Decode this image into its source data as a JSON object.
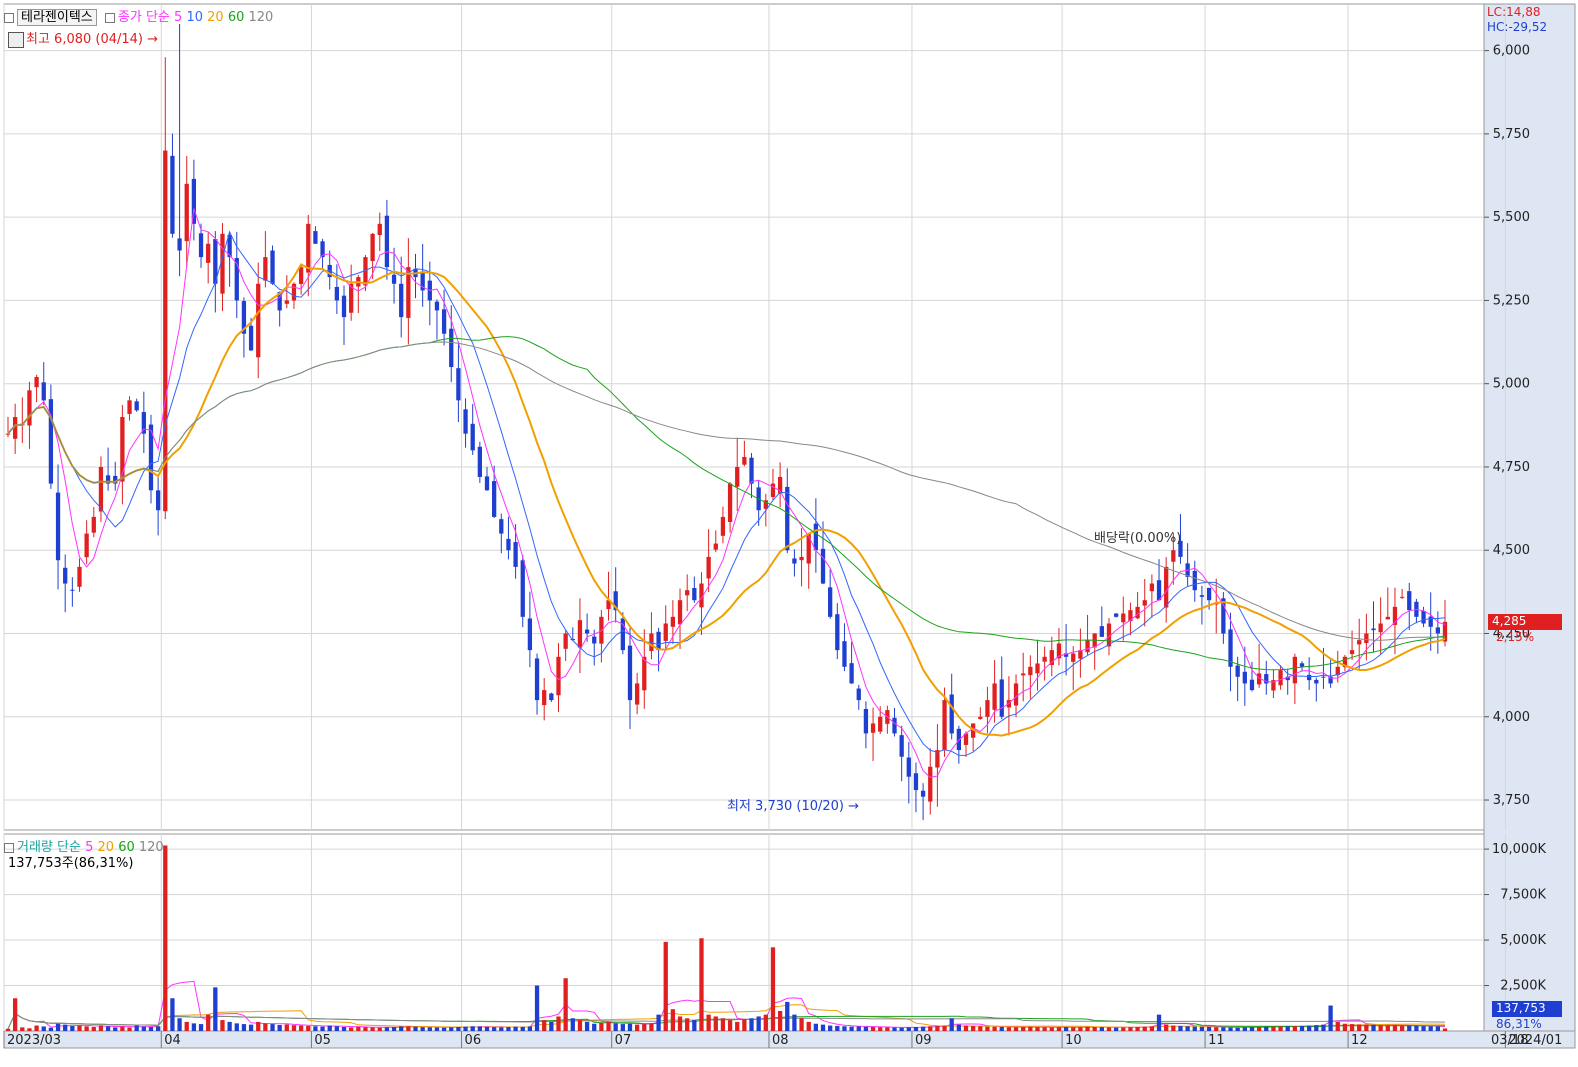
{
  "price_legend": {
    "stock_name": "테라젠이텍스",
    "label": "종가 단순",
    "periods": [
      "5",
      "10",
      "20",
      "60",
      "120"
    ]
  },
  "volume_legend": {
    "label": "거래량 단순",
    "periods": [
      "5",
      "20",
      "60",
      "120"
    ],
    "current_volume": "137,753주(86,31%)"
  },
  "annotations": {
    "high": "최고 6,080 (04/14)",
    "low": "최저 3,730 (10/20)",
    "dividend": "배당락(0.00%)",
    "lc": "LC:14,88",
    "hc": "HC:-29,52",
    "last_price": "4,285",
    "last_change": "2,15%",
    "last_volume": "137,753",
    "last_volume_pct": "86,31%"
  },
  "colors": {
    "up": "#e02020",
    "down": "#1f3fd0",
    "ma5": "#ff33ff",
    "ma10": "#3366ff",
    "ma20": "#f0a000",
    "ma60": "#1aa31a",
    "ma120": "#888888",
    "axis_bg": "#dfe6f3",
    "grid": "#d6d6d6"
  },
  "chart_data": [
    {
      "type": "candlestick",
      "x_ticks": [
        "2023/03",
        "04",
        "05",
        "06",
        "07",
        "08",
        "09",
        "10",
        "11",
        "12",
        "2024/01",
        "02",
        "03",
        "03/18"
      ],
      "y_ticks": [
        "6,000",
        "5,750",
        "5,500",
        "5,250",
        "5,000",
        "4,750",
        "4,500",
        "4,250",
        "4,000",
        "3,750"
      ],
      "ylim": [
        3660,
        6140
      ],
      "moving_averages": [
        "5",
        "10",
        "20",
        "60",
        "120"
      ],
      "series": [
        {
          "name": "종가",
          "values": [
            4850,
            4900,
            4880,
            4980,
            5020,
            4950,
            4700,
            4470,
            4400,
            4380,
            4450,
            4550,
            4600,
            4750,
            4700,
            4700,
            4900,
            4950,
            4920,
            4850,
            4680,
            4620,
            5700,
            5450,
            5400,
            5600,
            5480,
            5380,
            5420,
            5300,
            5450,
            5380,
            5250,
            5150,
            5100,
            5300,
            5380,
            5300,
            5220,
            5250,
            5300,
            5350,
            5480,
            5420,
            5380,
            5320,
            5250,
            5200,
            5300,
            5320,
            5380,
            5450,
            5480,
            5350,
            5300,
            5200,
            5350,
            5320,
            5280,
            5250,
            5220,
            5150,
            5050,
            4950,
            4850,
            4800,
            4720,
            4680,
            4600,
            4550,
            4500,
            4450,
            4300,
            4200,
            4050,
            4080,
            4050,
            4180,
            4250,
            4230,
            4290,
            4250,
            4220,
            4300,
            4350,
            4320,
            4200,
            4050,
            4100,
            4180,
            4250,
            4200,
            4280,
            4300,
            4350,
            4380,
            4350,
            4400,
            4480,
            4520,
            4600,
            4700,
            4750,
            4780,
            4700,
            4620,
            4650,
            4700,
            4720,
            4500,
            4460,
            4480,
            4550,
            4500,
            4400,
            4300,
            4200,
            4150,
            4100,
            4050,
            3950,
            3980,
            4000,
            4020,
            3950,
            3880,
            3820,
            3780,
            3760,
            3850,
            3900,
            4050,
            3950,
            3900,
            3950,
            3980,
            4000,
            4050,
            4100,
            4000,
            4050,
            4100,
            4130,
            4150,
            4160,
            4180,
            4200,
            4220,
            4180,
            4190,
            4200,
            4230,
            4250,
            4240,
            4280,
            4300,
            4310,
            4320,
            4330,
            4350,
            4400,
            4350,
            4450,
            4500,
            4480,
            4420,
            4380,
            4360,
            4350,
            4340,
            4250,
            4150,
            4120,
            4100,
            4080,
            4130,
            4100,
            4110,
            4140,
            4110,
            4180,
            4150,
            4110,
            4100,
            4120,
            4100,
            4150,
            4180,
            4200,
            4230,
            4250,
            4260,
            4280,
            4300,
            4330,
            4360,
            4320,
            4300,
            4280,
            4270,
            4250,
            4285
          ]
        }
      ],
      "high": {
        "value": 6080,
        "date": "04/14"
      },
      "low": {
        "value": 3730,
        "date": "10/20"
      },
      "last_close": 4285
    },
    {
      "type": "bar",
      "title": "거래량",
      "y_ticks": [
        "10,000K",
        "7,500K",
        "5,000K",
        "2,500K"
      ],
      "ylim": [
        0,
        10500
      ],
      "series": [
        {
          "name": "거래량",
          "values": [
            120,
            1800,
            200,
            150,
            300,
            250,
            180,
            400,
            350,
            280,
            300,
            260,
            220,
            310,
            260,
            200,
            240,
            190,
            300,
            250,
            220,
            260,
            10200,
            1800,
            700,
            500,
            420,
            380,
            900,
            2400,
            600,
            500,
            420,
            380,
            350,
            500,
            420,
            380,
            330,
            360,
            320,
            300,
            280,
            260,
            240,
            300,
            260,
            220,
            200,
            230,
            210,
            190,
            180,
            200,
            220,
            250,
            260,
            240,
            210,
            200,
            190,
            180,
            200,
            220,
            240,
            260,
            250,
            230,
            210,
            200,
            220,
            240,
            230,
            250,
            2500,
            600,
            500,
            800,
            2900,
            700,
            600,
            500,
            400,
            450,
            500,
            420,
            380,
            400,
            350,
            380,
            420,
            900,
            4900,
            1200,
            800,
            700,
            600,
            5100,
            900,
            800,
            700,
            600,
            500,
            650,
            700,
            800,
            900,
            4600,
            1100,
            1600,
            900,
            700,
            500,
            400,
            350,
            300,
            280,
            260,
            240,
            250,
            230,
            220,
            210,
            200,
            190,
            180,
            200,
            220,
            240,
            260,
            280,
            300,
            700,
            350,
            300,
            280,
            260,
            240,
            230,
            220,
            210,
            200,
            220,
            230,
            210,
            200,
            190,
            210,
            220,
            200,
            210,
            230,
            220,
            210,
            200,
            190,
            200,
            210,
            220,
            240,
            260,
            900,
            350,
            300,
            280,
            260,
            240,
            230,
            220,
            210,
            200,
            190,
            180,
            200,
            210,
            220,
            230,
            240,
            250,
            260,
            270,
            280,
            300,
            320,
            350,
            1400,
            500,
            400,
            380,
            360,
            350,
            340,
            330,
            320,
            310,
            300,
            290,
            280,
            270,
            260,
            250,
            138
          ]
        }
      ]
    }
  ]
}
